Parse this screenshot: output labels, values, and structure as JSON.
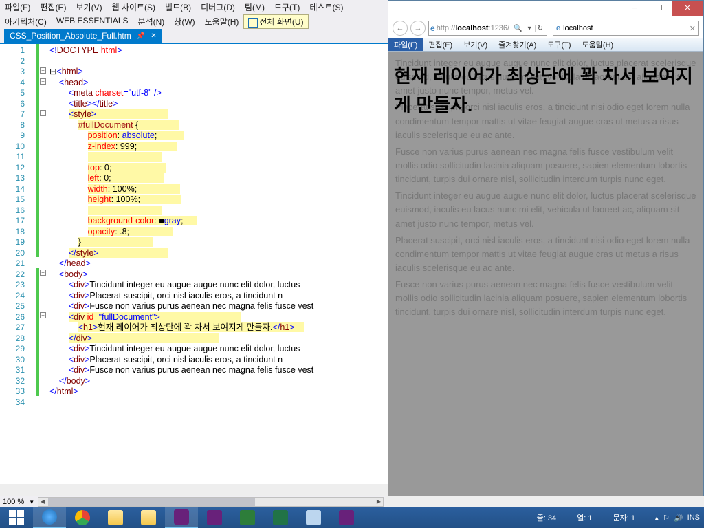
{
  "vs_menu_row1": [
    "파일(F)",
    "편집(E)",
    "보기(V)",
    "웹 사이트(S)",
    "빌드(B)",
    "디버그(D)",
    "팀(M)",
    "도구(T)",
    "테스트(S)"
  ],
  "vs_menu_row2": [
    "아키텍처(C)",
    "WEB ESSENTIALS",
    "분석(N)",
    "창(W)",
    "도움말(H)"
  ],
  "fullscreen_label": "전체 화면(U)",
  "tab_filename": "CSS_Position_Absolute_Full.htm",
  "zoom": "100 %",
  "code_lines": [
    [
      [
        "<!",
        "t-blue"
      ],
      [
        "DOCTYPE",
        "t-brown"
      ],
      [
        " ",
        ""
      ],
      [
        "html",
        "t-red"
      ],
      [
        ">",
        "t-blue"
      ]
    ],
    [],
    [
      [
        "⊟",
        "hidden"
      ],
      [
        "<",
        "t-blue"
      ],
      [
        "html",
        "t-brown"
      ],
      [
        ">",
        "t-blue"
      ]
    ],
    [
      [
        "    ",
        ""
      ],
      [
        "<",
        "t-blue"
      ],
      [
        "head",
        "t-brown"
      ],
      [
        ">",
        "t-blue"
      ]
    ],
    [
      [
        "        ",
        ""
      ],
      [
        "<",
        "t-blue"
      ],
      [
        "meta",
        "t-brown"
      ],
      [
        " ",
        ""
      ],
      [
        "charset",
        "t-red"
      ],
      [
        "=\"utf-8\"",
        "t-blue"
      ],
      [
        " />",
        "t-blue"
      ]
    ],
    [
      [
        "        ",
        ""
      ],
      [
        "<",
        "t-blue"
      ],
      [
        "title",
        "t-brown"
      ],
      [
        "></",
        "t-blue"
      ],
      [
        "title",
        "t-brown"
      ],
      [
        ">",
        "t-blue"
      ]
    ],
    [
      [
        "        ",
        ""
      ],
      [
        "<",
        "t-blue hl"
      ],
      [
        "style",
        "t-brown hl"
      ],
      [
        ">",
        "t-blue hl"
      ],
      [
        "                              ",
        "hl"
      ]
    ],
    [
      [
        "            ",
        ""
      ],
      [
        "#fullDocument",
        "t-maroon hl"
      ],
      [
        " {",
        "hl"
      ],
      [
        "                 ",
        "hl"
      ]
    ],
    [
      [
        "                ",
        ""
      ],
      [
        "position",
        "t-red hl"
      ],
      [
        ": ",
        "hl"
      ],
      [
        "absolute",
        "t-blue hl"
      ],
      [
        ";",
        "hl"
      ],
      [
        "           ",
        "hl"
      ]
    ],
    [
      [
        "                ",
        ""
      ],
      [
        "z-index",
        "t-red hl"
      ],
      [
        ": ",
        "hl"
      ],
      [
        "999",
        "hl"
      ],
      [
        ";",
        "hl"
      ],
      [
        "                 ",
        "hl"
      ]
    ],
    [
      [
        "                ",
        ""
      ],
      [
        "                               ",
        "hl"
      ]
    ],
    [
      [
        "                ",
        ""
      ],
      [
        "top",
        "t-red hl"
      ],
      [
        ": ",
        "hl"
      ],
      [
        "0",
        "hl"
      ],
      [
        ";",
        "hl"
      ],
      [
        "                       ",
        "hl"
      ]
    ],
    [
      [
        "                ",
        ""
      ],
      [
        "left",
        "t-red hl"
      ],
      [
        ": ",
        "hl"
      ],
      [
        "0",
        "hl"
      ],
      [
        ";",
        "hl"
      ],
      [
        "                      ",
        "hl"
      ]
    ],
    [
      [
        "                ",
        ""
      ],
      [
        "width",
        "t-red hl"
      ],
      [
        ": ",
        "hl"
      ],
      [
        "100%",
        "hl"
      ],
      [
        ";",
        "hl"
      ],
      [
        "                  ",
        "hl"
      ]
    ],
    [
      [
        "                ",
        ""
      ],
      [
        "height",
        "t-red hl"
      ],
      [
        ": ",
        "hl"
      ],
      [
        "100%",
        "hl"
      ],
      [
        ";",
        "hl"
      ],
      [
        "                 ",
        "hl"
      ]
    ],
    [
      [
        "                ",
        ""
      ],
      [
        "                               ",
        "hl"
      ]
    ],
    [
      [
        "                ",
        ""
      ],
      [
        "background-color",
        "t-red hl"
      ],
      [
        ": ",
        "hl"
      ],
      [
        "■",
        "hl"
      ],
      [
        "gray",
        "t-blue hl"
      ],
      [
        ";",
        "hl"
      ],
      [
        "      ",
        "hl"
      ]
    ],
    [
      [
        "                ",
        ""
      ],
      [
        "opacity",
        "t-red hl"
      ],
      [
        ": ",
        "hl"
      ],
      [
        ".8",
        "hl"
      ],
      [
        ";",
        "hl"
      ],
      [
        "                  ",
        "hl"
      ]
    ],
    [
      [
        "            ",
        ""
      ],
      [
        "}",
        "hl"
      ],
      [
        "                              ",
        "hl"
      ]
    ],
    [
      [
        "        ",
        ""
      ],
      [
        "</",
        "t-blue hl"
      ],
      [
        "style",
        "t-brown hl"
      ],
      [
        ">",
        "t-blue hl"
      ],
      [
        "                             ",
        "hl"
      ]
    ],
    [
      [
        "    ",
        ""
      ],
      [
        "</",
        "t-blue"
      ],
      [
        "head",
        "t-brown"
      ],
      [
        ">",
        "t-blue"
      ]
    ],
    [
      [
        "    ",
        ""
      ],
      [
        "<",
        "t-blue"
      ],
      [
        "body",
        "t-brown"
      ],
      [
        ">",
        "t-blue"
      ]
    ],
    [
      [
        "        ",
        ""
      ],
      [
        "<",
        "t-blue"
      ],
      [
        "div",
        "t-brown"
      ],
      [
        ">",
        "t-blue"
      ],
      [
        "Tincidunt integer eu augue augue nunc elit dolor, luctus",
        ""
      ]
    ],
    [
      [
        "        ",
        ""
      ],
      [
        "<",
        "t-blue"
      ],
      [
        "div",
        "t-brown"
      ],
      [
        ">",
        "t-blue"
      ],
      [
        "Placerat suscipit, orci nisl iaculis eros, a tincidunt n",
        ""
      ]
    ],
    [
      [
        "        ",
        ""
      ],
      [
        "<",
        "t-blue"
      ],
      [
        "div",
        "t-brown"
      ],
      [
        ">",
        "t-blue"
      ],
      [
        "Fusce non varius purus aenean nec magna felis fusce vest",
        ""
      ]
    ],
    [
      [
        "        ",
        ""
      ],
      [
        "<",
        "t-blue hl"
      ],
      [
        "div",
        "t-brown hl"
      ],
      [
        " ",
        "hl"
      ],
      [
        "id",
        "t-red hl"
      ],
      [
        "=\"fullDocument\"",
        "t-blue hl"
      ],
      [
        ">",
        "t-blue hl"
      ],
      [
        "                                  ",
        "hl"
      ]
    ],
    [
      [
        "            ",
        ""
      ],
      [
        "<",
        "t-blue hl"
      ],
      [
        "h1",
        "t-brown hl"
      ],
      [
        ">",
        "t-blue hl"
      ],
      [
        "현재 레이어가 최상단에 꽉 차서 보여지게 만들자.",
        "hl"
      ],
      [
        "</",
        "t-blue hl"
      ],
      [
        "h1",
        "t-brown hl"
      ],
      [
        ">",
        "t-blue hl"
      ],
      [
        "    ",
        "hl"
      ]
    ],
    [
      [
        "        ",
        ""
      ],
      [
        "</",
        "t-blue hl"
      ],
      [
        "div",
        "t-brown hl"
      ],
      [
        ">",
        "t-blue hl"
      ],
      [
        "                                                     ",
        "hl"
      ]
    ],
    [
      [
        "        ",
        ""
      ],
      [
        "<",
        "t-blue"
      ],
      [
        "div",
        "t-brown"
      ],
      [
        ">",
        "t-blue"
      ],
      [
        "Tincidunt integer eu augue augue nunc elit dolor, luctus",
        ""
      ]
    ],
    [
      [
        "        ",
        ""
      ],
      [
        "<",
        "t-blue"
      ],
      [
        "div",
        "t-brown"
      ],
      [
        ">",
        "t-blue"
      ],
      [
        "Placerat suscipit, orci nisl iaculis eros, a tincidunt n",
        ""
      ]
    ],
    [
      [
        "        ",
        ""
      ],
      [
        "<",
        "t-blue"
      ],
      [
        "div",
        "t-brown"
      ],
      [
        ">",
        "t-blue"
      ],
      [
        "Fusce non varius purus aenean nec magna felis fusce vest",
        ""
      ]
    ],
    [
      [
        "    ",
        ""
      ],
      [
        "</",
        "t-blue"
      ],
      [
        "body",
        "t-brown"
      ],
      [
        ">",
        "t-blue"
      ]
    ],
    [
      [
        "</",
        "t-blue"
      ],
      [
        "html",
        "t-brown"
      ],
      [
        ">",
        "t-blue"
      ]
    ],
    []
  ],
  "ie": {
    "url": "http://localhost:1236/",
    "title": "localhost",
    "menu": [
      "파일(F)",
      "편집(E)",
      "보기(V)",
      "즐겨찾기(A)",
      "도구(T)",
      "도움말(H)"
    ],
    "overlay_heading": "현재 레이어가 최상단에 꽉 차서 보여지게 만들자.",
    "paragraphs": [
      "Tincidunt integer eu augue augue nunc elit dolor, luctus placerat scelerisque euismod, iaculis eu lacus nunc mi elit, vehicula ut laoreet ac, aliquam sit amet justo nunc tempor, metus vel.",
      "Placerat suscipit, orci nisl iaculis eros, a tincidunt nisi odio eget lorem nulla condimentum tempor mattis ut vitae feugiat augue cras ut metus a risus iaculis scelerisque eu ac ante.",
      "Fusce non varius purus aenean nec magna felis fusce vestibulum velit mollis odio sollicitudin lacinia aliquam posuere, sapien elementum lobortis tincidunt, turpis dui ornare nisl, sollicitudin interdum turpis nunc eget.",
      "Tincidunt integer eu augue augue nunc elit dolor, luctus placerat scelerisque euismod, iaculis eu lacus nunc mi elit, vehicula ut laoreet ac, aliquam sit amet justo nunc tempor, metus vel.",
      "Placerat suscipit, orci nisl iaculis eros, a tincidunt nisi odio eget lorem nulla condimentum tempor mattis ut vitae feugiat augue cras ut metus a risus iaculis scelerisque eu ac ante.",
      "Fusce non varius purus aenean nec magna felis fusce vestibulum velit mollis odio sollicitudin lacinia aliquam posuere, sapien elementum lobortis tincidunt, turpis dui ornare nisl, sollicitudin interdum turpis nunc eget."
    ]
  },
  "statusbar": {
    "line_label": "줄:",
    "line": "34",
    "col_label": "열:",
    "col": "1",
    "char_label": "문자:",
    "char": "1",
    "ins": "INS"
  },
  "taskbar_icons": [
    "start",
    "ie",
    "chrome",
    "explorer",
    "control",
    "vs1",
    "vs2",
    "vs3",
    "excel",
    "notepad",
    "vs4"
  ]
}
